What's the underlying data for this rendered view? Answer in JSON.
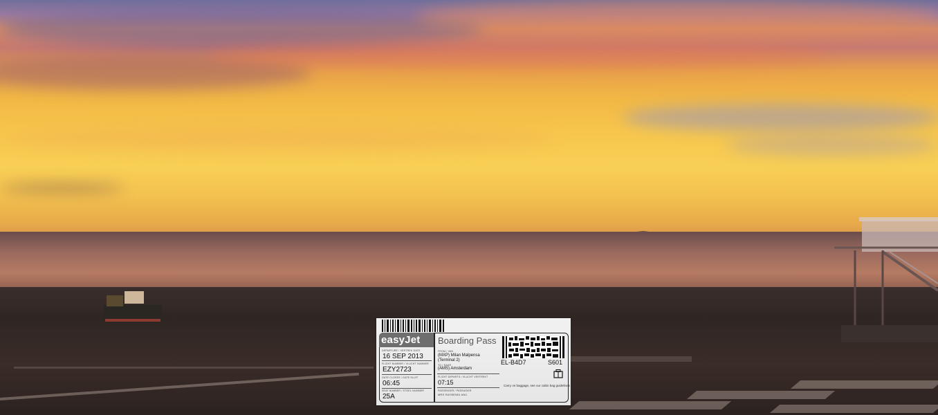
{
  "scene": {
    "description_colors": {
      "sky_top": "#6f6f9c",
      "sky_mid": "#f7c64c",
      "haze": "#b67b62",
      "tarmac": "#2f2624"
    }
  },
  "boarding_pass": {
    "brand": "easyJet",
    "title": "Boarding Pass",
    "date_label": "DEPARTURE / VERTREK DATE",
    "date": "16 SEP 2013",
    "flight_label": "FLIGHT NUMBER / VLUCHT NUMMER",
    "flight": "EZY2723",
    "time_label": "GATE CLOSES / GATE SLUIT",
    "time": "06:45",
    "seat_label": "SEAT NUMBER / STOEL NUMMER",
    "seat": "25A",
    "from_label": "FROM / VAN",
    "from": "(MXP) Milan Malpensa",
    "terminal": "(Terminal 2)",
    "to_label": "TO / NAAR",
    "to": "(AMS) Amsterdam",
    "dep_label": "FLIGHT DEPARTS / VLUCHT VERTREKT",
    "departs": "07:15",
    "codes_left": "EL-B4D7",
    "codes_right": "S601",
    "footer_label": "PASSENGER / PASSAGIER",
    "footer": "MRS RAYBENDI ANC",
    "note": "Carry on baggage, see our cabin bag guidelines"
  }
}
